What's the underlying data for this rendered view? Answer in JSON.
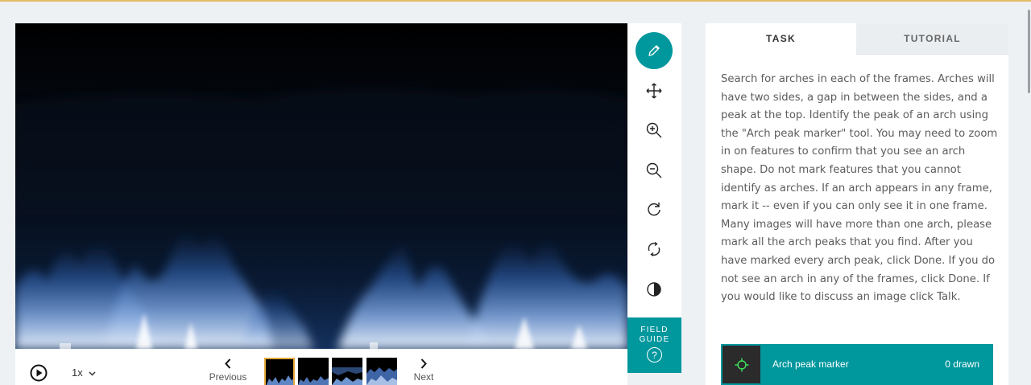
{
  "colors": {
    "accent": "#00979d",
    "selected_frame": "#e4a93a",
    "top_border": "#e4bd64"
  },
  "toolbar": {
    "tools": [
      {
        "name": "draw",
        "icon": "pencil-icon",
        "active": true
      },
      {
        "name": "move",
        "icon": "move-arrows-icon"
      },
      {
        "name": "zoom-in",
        "icon": "zoom-in-icon"
      },
      {
        "name": "zoom-out",
        "icon": "zoom-out-icon"
      },
      {
        "name": "rotate",
        "icon": "rotate-icon"
      },
      {
        "name": "reset",
        "icon": "reset-icon"
      },
      {
        "name": "invert",
        "icon": "invert-contrast-icon"
      }
    ],
    "field_guide_label": "FIELD GUIDE",
    "field_guide_icon": "?"
  },
  "controls": {
    "play_icon": "play-icon",
    "speed": "1x",
    "previous_label": "Previous",
    "next_label": "Next",
    "frames": [
      {
        "selected": true
      },
      {
        "selected": false
      },
      {
        "selected": false
      },
      {
        "selected": false
      }
    ]
  },
  "panel": {
    "tabs": {
      "task": "TASK",
      "tutorial": "TUTORIAL"
    },
    "instructions": "Search for arches in each of the frames. Arches will have two sides, a gap in between the sides, and a peak at the top. Identify the peak of an arch using the \"Arch peak marker\" tool. You may need to zoom in on features to confirm that you see an arch shape. Do not mark features that you cannot identify as arches. If an arch appears in any frame, mark it -- even if you can only see it in one frame. Many images will have more than one arch, please mark all the arch peaks that you find. After you have marked every arch peak, click Done. If you do not see an arch in any of the frames, click Done. If you would like to discuss an image click Talk.",
    "tool_option": {
      "label": "Arch peak marker",
      "count": "0 drawn",
      "icon": "crosshair-icon"
    }
  }
}
